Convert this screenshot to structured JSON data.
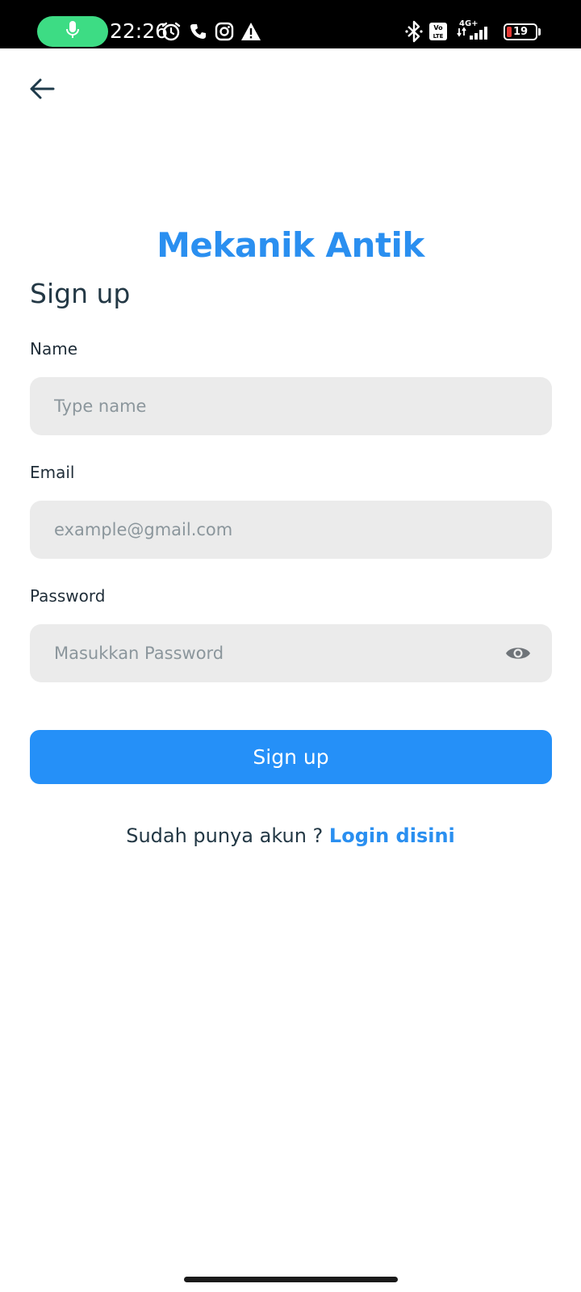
{
  "status_bar": {
    "time": "22:26",
    "network_label_top": "4G+",
    "volte_label": "Vo LTE",
    "battery_level": "19",
    "icons": [
      "mic-icon",
      "alarm-icon",
      "phone-icon",
      "instagram-icon",
      "warning-icon",
      "bluetooth-icon",
      "volte-icon",
      "signal-icon",
      "battery-icon"
    ],
    "accent_colors": {
      "mic_pill": "#3ddc84",
      "battery_low": "#e53935"
    }
  },
  "header": {
    "back_icon": "arrow-left-icon"
  },
  "brand": {
    "app_name": "Mekanik Antik",
    "color": "#2a8ff0"
  },
  "form": {
    "title": "Sign up",
    "fields": [
      {
        "label": "Name",
        "value": "",
        "placeholder": "Type name",
        "type": "text"
      },
      {
        "label": "Email",
        "value": "",
        "placeholder": "example@gmail.com",
        "type": "email"
      },
      {
        "label": "Password",
        "value": "",
        "placeholder": "Masukkan Password",
        "type": "password",
        "toggle_icon": "eye-icon"
      }
    ],
    "submit_label": "Sign up",
    "submit_color": "#2590f8"
  },
  "footer": {
    "prompt": "Sudah punya akun ?",
    "link_label": "Login disini"
  }
}
